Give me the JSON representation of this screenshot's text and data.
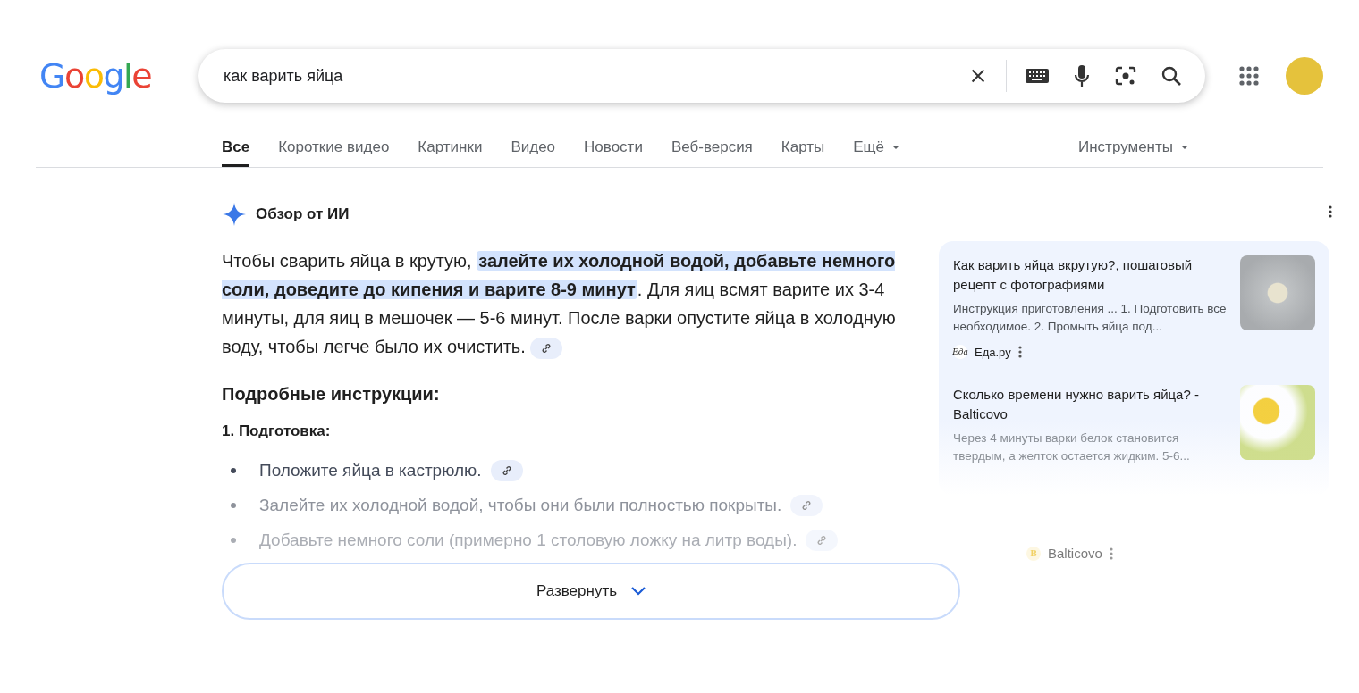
{
  "logo": "Google",
  "search": {
    "value": "как варить яйца"
  },
  "tabs": [
    {
      "label": "Все",
      "selected": true,
      "dropdown": false
    },
    {
      "label": "Короткие видео",
      "selected": false,
      "dropdown": false
    },
    {
      "label": "Картинки",
      "selected": false,
      "dropdown": false
    },
    {
      "label": "Видео",
      "selected": false,
      "dropdown": false
    },
    {
      "label": "Новости",
      "selected": false,
      "dropdown": false
    },
    {
      "label": "Веб-версия",
      "selected": false,
      "dropdown": false
    },
    {
      "label": "Карты",
      "selected": false,
      "dropdown": false
    },
    {
      "label": "Ещё",
      "selected": false,
      "dropdown": true
    }
  ],
  "tools": "Инструменты",
  "ai_overview": {
    "title": "Обзор от ИИ",
    "summary": "Чтобы сварить яйца в крутую, **залейте их холодной водой, добавьте немного соли, доведите до кипения и варите 8-9 минут**. Для яиц всмят варите их 3-4 минуты, для яиц в мешочек — 5-6 минут. После варки опустите яйца в холодную воду, чтобы легче было их очистить.",
    "heading": "Подробные инструкции:",
    "step": "1. Подготовка:",
    "bullets": [
      "Положите яйца в кастрюлю.",
      "Залейте их холодной водой, чтобы они были полностью покрыты.",
      "Добавьте немного соли (примерно 1 столовую ложку на литр воды)."
    ],
    "expand": "Развернуть",
    "sources": [
      {
        "title": "Как варить яйца вкрутую?, пошаговый рецепт с фотографиями",
        "snippet": "Инструкция приготовления ... 1. Подготовить все необходимое. 2. Промыть яйца под...",
        "site_logo": "Еда",
        "site": "Еда.ру"
      },
      {
        "title": "Сколько времени нужно варить яйца? - Balticovo",
        "snippet": "Через 4 минуты варки белок становится твердым, а желток остается жидким. 5-6...",
        "site_logo": "B",
        "site": "Balticovo"
      }
    ]
  }
}
